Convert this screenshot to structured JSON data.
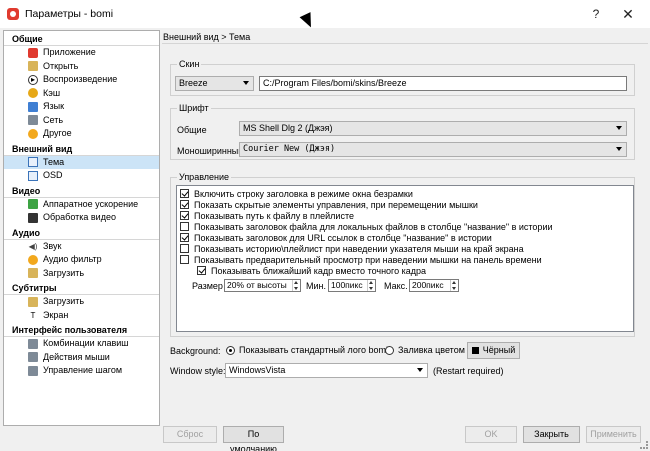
{
  "window": {
    "title": "Параметры - bomi",
    "help_glyph": "?",
    "close_glyph": "✕"
  },
  "sidebar": {
    "categories": [
      {
        "label": "Общие",
        "items": [
          {
            "label": "Приложение",
            "icon": "app-icon"
          },
          {
            "label": "Открыть",
            "icon": "folder-icon"
          },
          {
            "label": "Воспроизведение",
            "icon": "play-icon"
          },
          {
            "label": "Кэш",
            "icon": "cache-icon"
          },
          {
            "label": "Язык",
            "icon": "language-icon"
          },
          {
            "label": "Сеть",
            "icon": "network-icon"
          },
          {
            "label": "Другое",
            "icon": "gear-icon"
          }
        ]
      },
      {
        "label": "Внешний вид",
        "items": [
          {
            "label": "Тема",
            "icon": "theme-icon",
            "selected": true
          },
          {
            "label": "OSD",
            "icon": "osd-icon"
          }
        ]
      },
      {
        "label": "Видео",
        "items": [
          {
            "label": "Аппаратное ускорение",
            "icon": "hardware-icon"
          },
          {
            "label": "Обработка видео",
            "icon": "film-icon"
          }
        ]
      },
      {
        "label": "Аудио",
        "items": [
          {
            "label": "Звук",
            "icon": "speaker-icon"
          },
          {
            "label": "Аудио фильтр",
            "icon": "filter-icon"
          },
          {
            "label": "Загрузить",
            "icon": "load-icon"
          }
        ]
      },
      {
        "label": "Субтитры",
        "items": [
          {
            "label": "Загрузить",
            "icon": "load-icon"
          },
          {
            "label": "Экран",
            "icon": "text-icon"
          }
        ]
      },
      {
        "label": "Интерфейс пользователя",
        "items": [
          {
            "label": "Комбинации клавиш",
            "icon": "keyboard-icon"
          },
          {
            "label": "Действия мыши",
            "icon": "mouse-icon"
          },
          {
            "label": "Управление шагом",
            "icon": "step-icon"
          }
        ]
      }
    ]
  },
  "breadcrumb": "Внешний вид > Тема",
  "skin": {
    "group_label": "Скин",
    "selected": "Breeze",
    "path": "C:/Program Files/bomi/skins/Breeze"
  },
  "font": {
    "group_label": "Шрифт",
    "general_label": "Общие",
    "general_value": "MS Shell Dlg 2 (Джэя)",
    "mono_label": "Моноширинный",
    "mono_value": "Courier New (Джэя)"
  },
  "control": {
    "group_label": "Управление",
    "options": [
      {
        "label": "Включить строку заголовка в режиме окна безрамки",
        "checked": true
      },
      {
        "label": "Показать скрытые элементы управления, при перемещении мышки",
        "checked": true
      },
      {
        "label": "Показывать путь к файлу в плейлисте",
        "checked": true
      },
      {
        "label": "Показывать заголовок файла для локальных файлов в столбце \"название\" в истории",
        "checked": false
      },
      {
        "label": "Показывать заголовок для URL ссылок в столбце \"название\" в истории",
        "checked": true
      },
      {
        "label": "Показывать историю\\плейлист при наведении указателя мыши на край экрана",
        "checked": false
      },
      {
        "label": "Показывать предварительный просмотр при наведении мышки на панель времени",
        "checked": false
      }
    ],
    "nearest_frame_label": "Показывать ближайший кадр вместо точного кадра",
    "nearest_frame_checked": true,
    "size_label": "Размер",
    "size_value": "20% от высоты",
    "min_label": "Мин.",
    "min_value": "100пикс",
    "max_label": "Макс.",
    "max_value": "200пикс"
  },
  "background": {
    "label": "Background:",
    "option_logo": "Показывать стандартный лого bomi",
    "option_fill": "Заливка цветом",
    "selected": "logo",
    "color_button": "Чёрный",
    "color": "#000000"
  },
  "window_style": {
    "label": "Window style:",
    "value": "WindowsVista",
    "note": "(Restart required)"
  },
  "footer": {
    "reset": "Сброс",
    "default": "По умолчанию",
    "ok": "OK",
    "close": "Закрыть",
    "apply": "Применить"
  }
}
